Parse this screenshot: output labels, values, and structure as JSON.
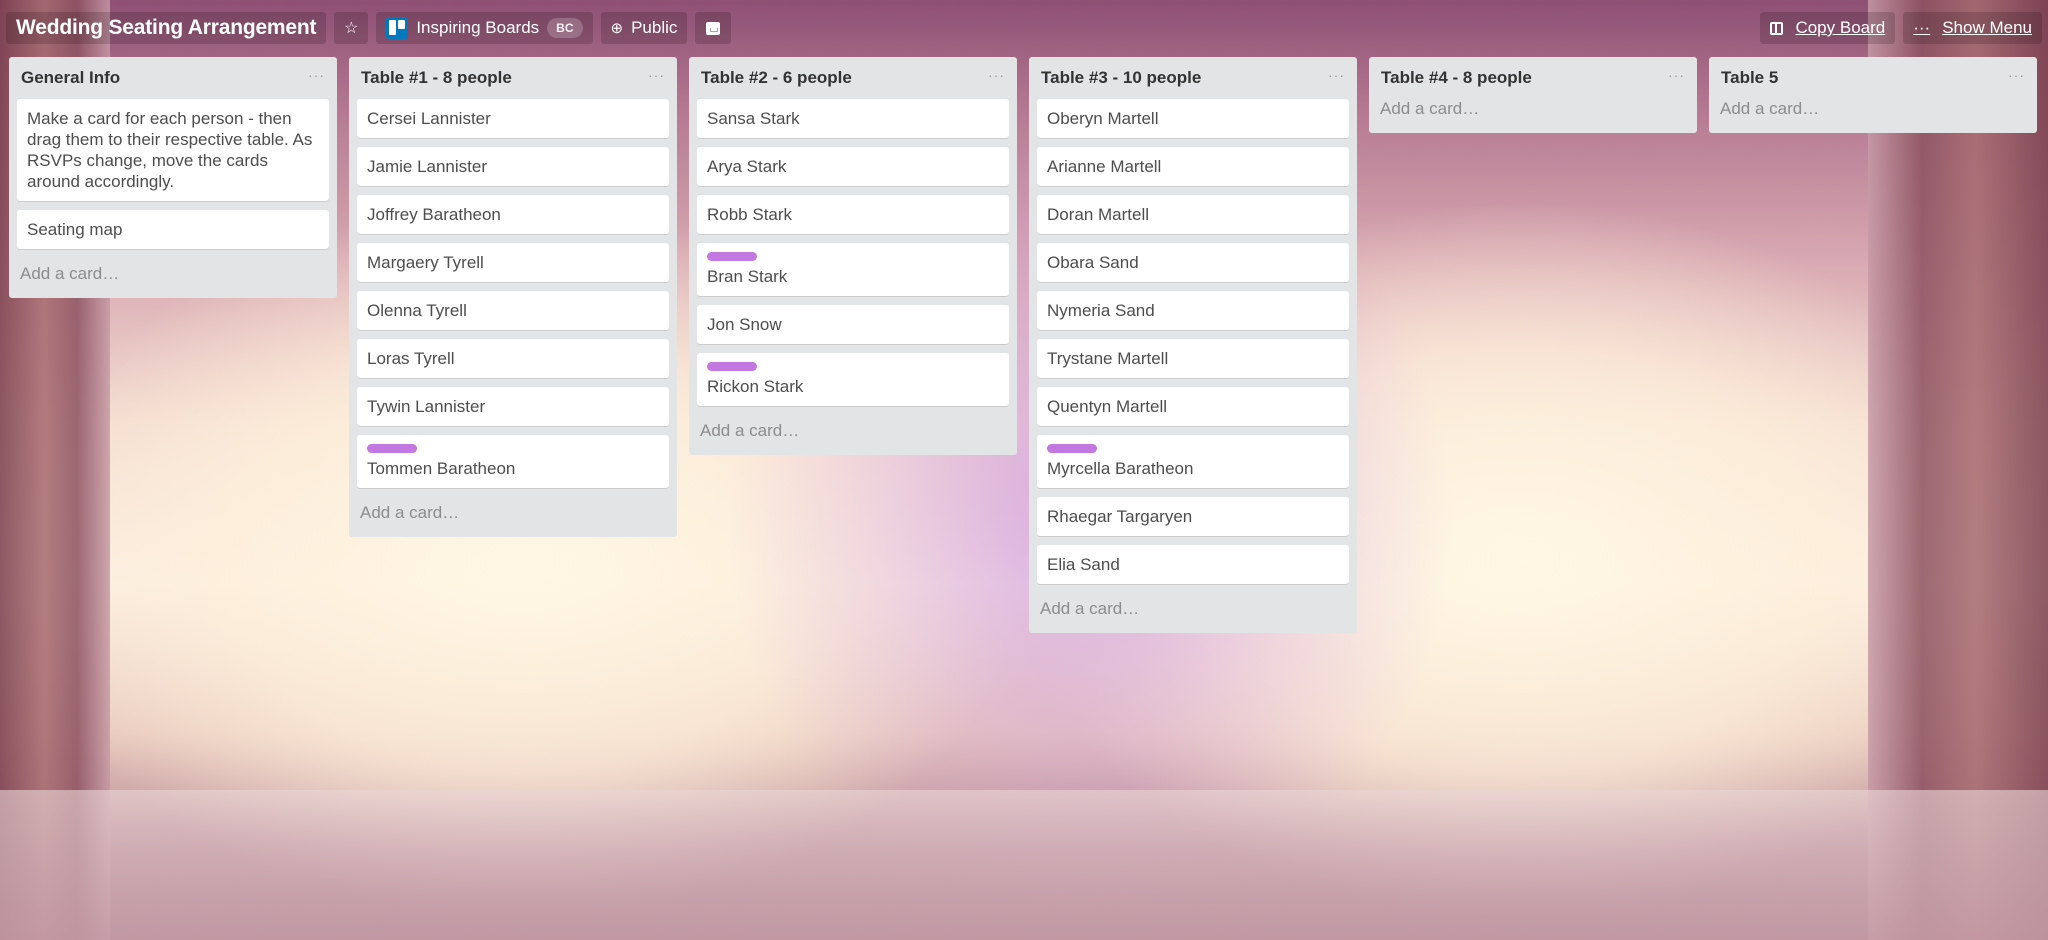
{
  "header": {
    "board_title": "Wedding Seating Arrangement",
    "star_icon": "star-icon",
    "team_name": "Inspiring Boards",
    "team_badge": "BC",
    "visibility": "Public",
    "visibility_icon": "globe-icon",
    "archive_icon": "archive-icon",
    "copy_board_label": "Copy Board",
    "show_menu_label": "Show Menu",
    "menu_dots": "···"
  },
  "label_color": "#c377e0",
  "list_menu_glyph": "···",
  "add_card_label": "Add a card…",
  "lists": [
    {
      "title": "General Info",
      "cards": [
        {
          "text": "Make a card for each person - then drag them to their respective table. As RSVPs change, move the cards around accordingly.",
          "label": false
        },
        {
          "text": "Seating map",
          "label": false
        }
      ]
    },
    {
      "title": "Table #1 - 8 people",
      "cards": [
        {
          "text": "Cersei Lannister",
          "label": false
        },
        {
          "text": "Jamie Lannister",
          "label": false
        },
        {
          "text": "Joffrey Baratheon",
          "label": false
        },
        {
          "text": "Margaery Tyrell",
          "label": false
        },
        {
          "text": "Olenna Tyrell",
          "label": false
        },
        {
          "text": "Loras Tyrell",
          "label": false
        },
        {
          "text": "Tywin Lannister",
          "label": false
        },
        {
          "text": "Tommen Baratheon",
          "label": true
        }
      ]
    },
    {
      "title": "Table #2 - 6 people",
      "cards": [
        {
          "text": "Sansa Stark",
          "label": false
        },
        {
          "text": "Arya Stark",
          "label": false
        },
        {
          "text": "Robb Stark",
          "label": false
        },
        {
          "text": "Bran Stark",
          "label": true
        },
        {
          "text": "Jon Snow",
          "label": false
        },
        {
          "text": "Rickon Stark",
          "label": true
        }
      ]
    },
    {
      "title": "Table #3 - 10 people",
      "cards": [
        {
          "text": "Oberyn Martell",
          "label": false
        },
        {
          "text": "Arianne Martell",
          "label": false
        },
        {
          "text": "Doran Martell",
          "label": false
        },
        {
          "text": "Obara Sand",
          "label": false
        },
        {
          "text": "Nymeria Sand",
          "label": false
        },
        {
          "text": "Trystane Martell",
          "label": false
        },
        {
          "text": "Quentyn Martell",
          "label": false
        },
        {
          "text": "Myrcella Baratheon",
          "label": true
        },
        {
          "text": "Rhaegar Targaryen",
          "label": false
        },
        {
          "text": "Elia Sand",
          "label": false
        }
      ]
    },
    {
      "title": "Table #4 - 8 people",
      "cards": []
    },
    {
      "title": "Table 5",
      "cards": []
    }
  ]
}
